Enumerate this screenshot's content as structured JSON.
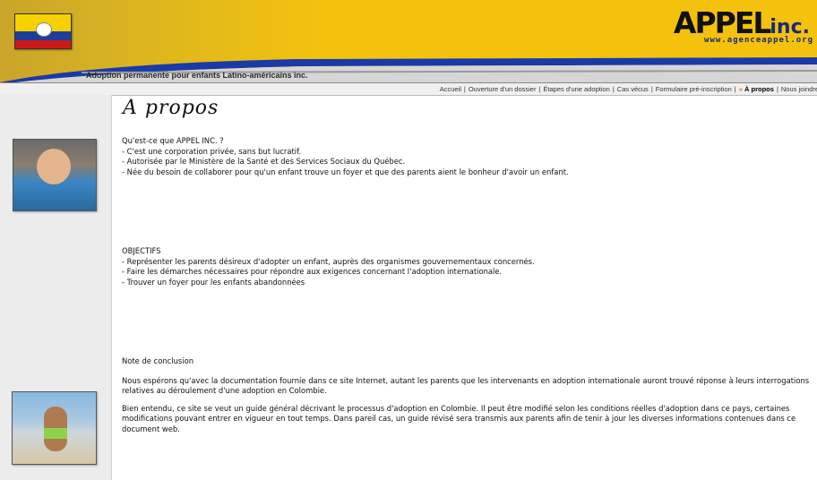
{
  "header": {
    "tagline": "Adoption permanente pour enfants Latino-américains inc.",
    "logo_main": "APPEL",
    "logo_inc": "inc.",
    "logo_url": "www.agenceappel.org"
  },
  "nav": {
    "items": [
      {
        "label": "Accueil"
      },
      {
        "label": "Ouverture d'un dossier"
      },
      {
        "label": "Étapes d'une adoption"
      },
      {
        "label": "Cas vécus"
      },
      {
        "label": "Formulaire pré-inscription"
      },
      {
        "label": "À propos",
        "current": true
      },
      {
        "label": "Nous joindre"
      }
    ],
    "current_marker": "»"
  },
  "page": {
    "title": "A propos",
    "intro": {
      "heading": "Qu'est-ce que APPEL INC. ?",
      "lines": [
        "- C'est une corporation privée, sans but lucratif.",
        "- Autorisée par le Ministère de la Santé et des Services Sociaux du Québec.",
        "- Née du besoin de collaborer pour qu'un enfant trouve un foyer et que des parents aient le bonheur d'avoir un enfant."
      ]
    },
    "objectives": {
      "heading": "OBJECTIFS",
      "lines": [
        "- Représenter les parents désireux d'adopter un enfant, auprès des organismes gouvernementaux concernés.",
        "- Faire les démarches nécessaires pour répondre aux exigences concernant l'adoption internationale.",
        "- Trouver un foyer pour les enfants abandonnées"
      ]
    },
    "conclusion": {
      "heading": "Note de conclusion",
      "p1": "Nous espérons qu'avec la documentation fournie dans ce site Internet, autant les parents que les intervenants en adoption internationale auront trouvé réponse à leurs interrogations relatives au déroulement d'une adoption en Colombie.",
      "p2": "Bien entendu, ce site se veut un guide général décrivant le processus d'adoption en Colombie. Il peut être modifié selon les conditions réelles d'adoption dans ce pays, certaines modifications pouvant entrer en vigueur en tout temps. Dans pareil cas, un guide révisé sera transmis aux parents afin de tenir à jour les diverses informations contenues dans ce document web."
    }
  },
  "colors": {
    "banner": "#f4c20d",
    "swoosh_blue": "#1a3aa8",
    "swoosh_grey": "#9a9a9a",
    "sidebar": "#ececec",
    "nav_marker": "#e08020"
  },
  "icons": {
    "flag": "colombia-flag-icon",
    "photo_top": "baby-photo",
    "photo_bottom": "child-beach-photo"
  }
}
